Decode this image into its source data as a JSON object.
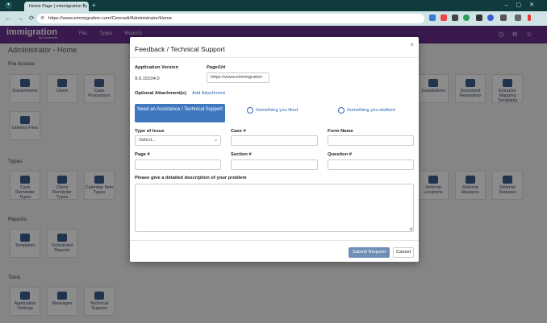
{
  "browser": {
    "tab_title": "Home Page | eimmigration by",
    "url": "https://www.eimmigration.com/Cennadi/Administrator/Home"
  },
  "app": {
    "logo": "immigration",
    "logo_sub": "by Cerenade",
    "nav": [
      "File",
      "Types",
      "Reports"
    ]
  },
  "page": {
    "title": "Administrator - Home",
    "sections": {
      "file_access": "File Access",
      "types": "Types",
      "reports": "Reports",
      "tools": "Tools"
    },
    "tiles": {
      "departments": "Departments",
      "users": "Users",
      "case_processors": "Case Processors",
      "deleted_files": "Deleted Files",
      "case_reminder_types": "Case Reminder Types",
      "client_reminder_types": "Client Reminder Types",
      "calendar_item_types": "Calendar Item Types",
      "templates": "Templates",
      "scheduled_reports": "Scheduled Reports",
      "application_settings": "Application Settings",
      "messages": "Messages",
      "technical_support": "Technical Support",
      "jurisdictions": "Jurisdictions",
      "document_repository": "Document Repository",
      "extractor_mapping_templates": "Extractor Mapping Templates",
      "referral_locations": "Referral Locations",
      "referral_reasons": "Referral Reasons",
      "referral_statuses": "Referral Statuses"
    }
  },
  "modal": {
    "title": "Feedback / Technical Support",
    "close": "×",
    "app_version_label": "Application Version",
    "app_version_value": "9.0.15104.0",
    "page_url_label": "Page/Url",
    "page_url_value": "https://www.eimmigration",
    "attachments_label": "Optional Attachment(s)",
    "add_attachment": "Add Attachment",
    "assist_button": "Need an Assistance / Technical Support",
    "liked": "Something you liked",
    "disliked": "Something you disliked",
    "issue_type_label": "Type of Issue",
    "issue_type_value": "Select...",
    "case_label": "Case #",
    "form_name_label": "Form Name",
    "page_label": "Page #",
    "section_label": "Section #",
    "question_label": "Question #",
    "description_label": "Please give a detailed description of your problem",
    "submit": "Submit Request",
    "cancel": "Cancel"
  }
}
